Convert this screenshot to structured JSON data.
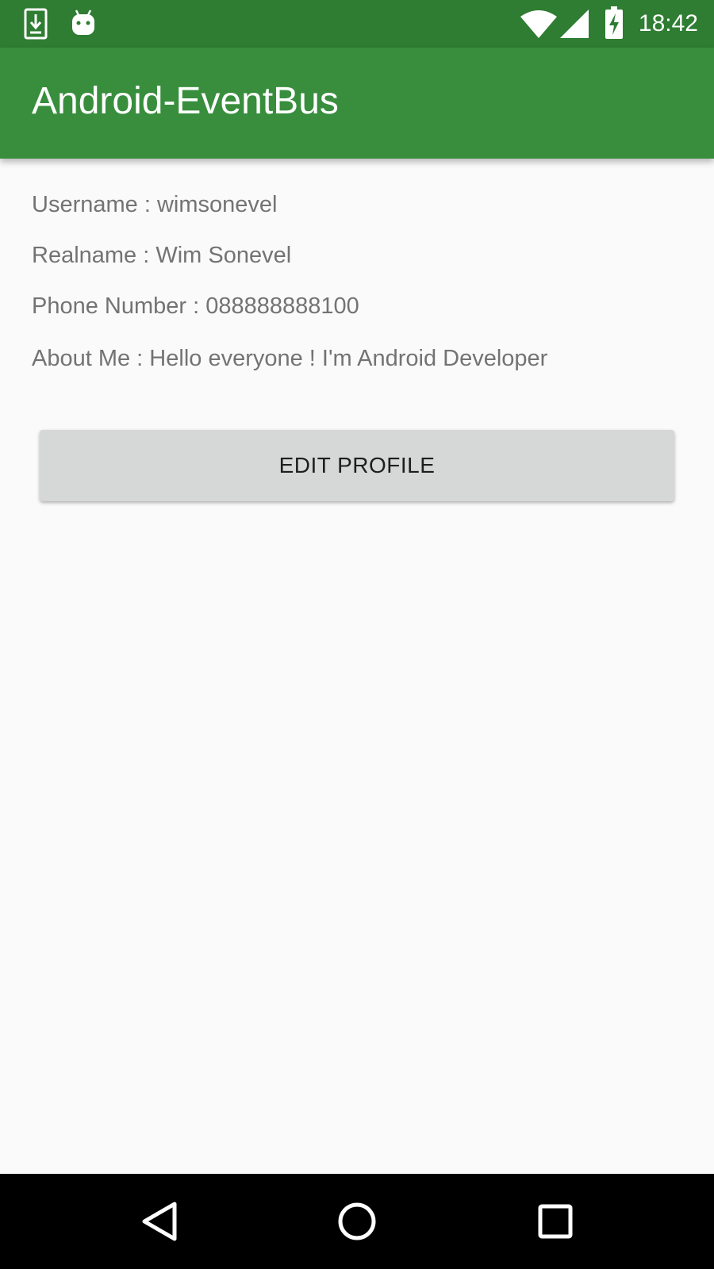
{
  "status_bar": {
    "time": "18:42",
    "left_icons": [
      "download-notification-icon",
      "android-notification-icon"
    ],
    "right_icons": [
      "wifi-icon",
      "cell-signal-icon",
      "battery-charging-icon"
    ]
  },
  "app_bar": {
    "title": "Android-EventBus"
  },
  "profile": {
    "username": "Username : wimsonevel",
    "realname": "Realname : Wim Sonevel",
    "phone": "Phone Number : 088888888100",
    "about": "About Me : Hello everyone ! I'm Android Developer"
  },
  "actions": {
    "edit_profile_label": "EDIT PROFILE"
  },
  "nav_bar": {
    "buttons": [
      "back-icon",
      "home-icon",
      "recents-icon"
    ]
  },
  "colors": {
    "status_bar": "#2E7D32",
    "app_bar": "#388E3C",
    "background": "#FAFAFA",
    "text": "#737373",
    "button": "#D6D7D7"
  }
}
